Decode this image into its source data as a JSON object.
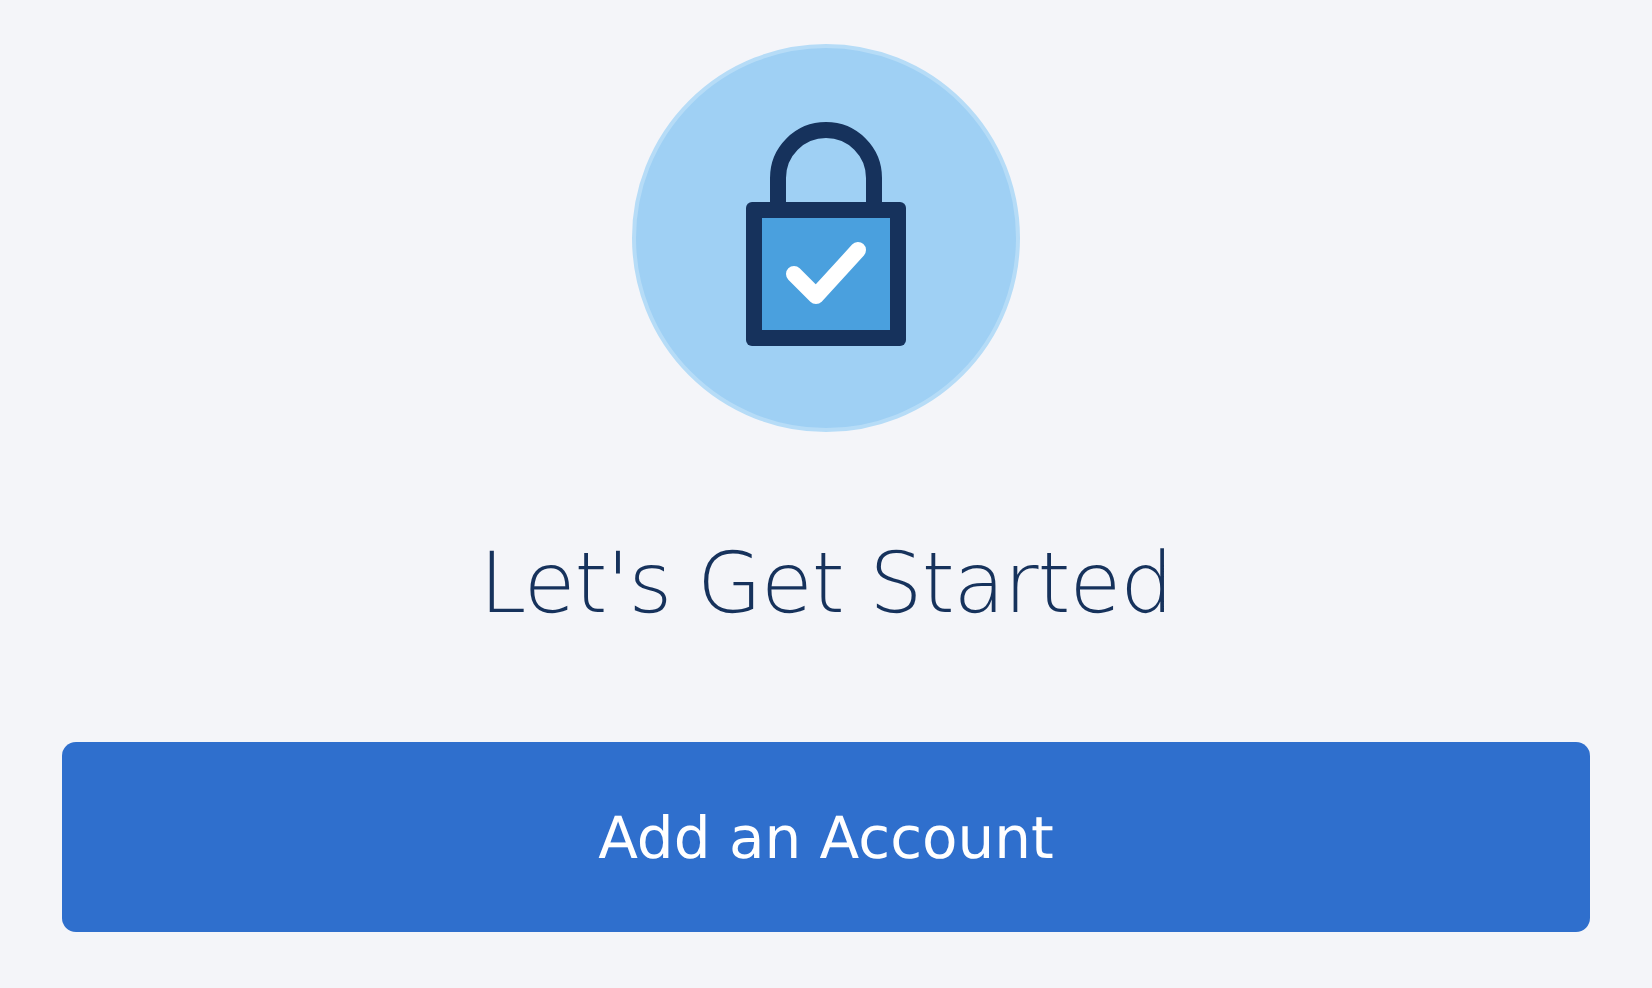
{
  "heading": "Let's Get Started",
  "button": {
    "label": "Add an Account"
  }
}
